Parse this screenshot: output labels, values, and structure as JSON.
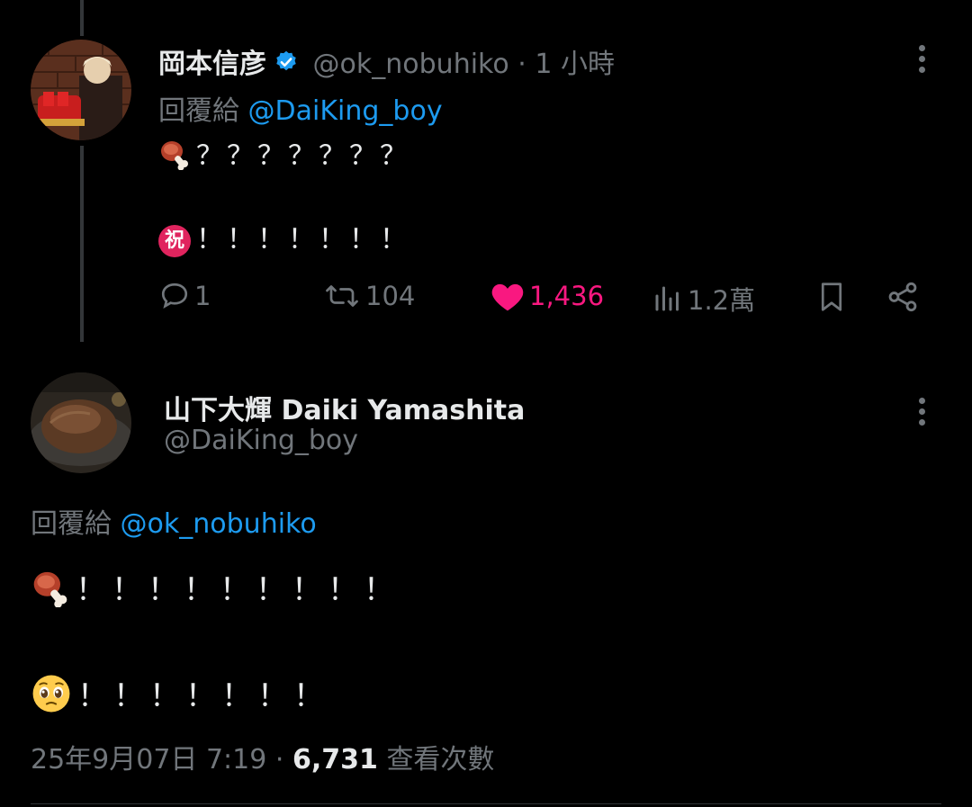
{
  "reply_tweet": {
    "display_name": "岡本信彦",
    "handle": "@ok_nobuhiko",
    "time": "· 1 小時",
    "reply_prefix": "回覆給",
    "reply_to": "@DaiKing_boy",
    "line1": "？？？？？？？",
    "line2": "！！！！！！！",
    "emoji1": "meat-on-bone-emoji",
    "emoji2": "congratulation-emoji",
    "congrat_char": "祝",
    "actions": {
      "replies": "1",
      "retweets": "104",
      "likes": "1,436",
      "views": "1.2萬"
    },
    "colors": {
      "like": "#f91880",
      "link": "#1d9bf0",
      "verified": "#1d9bf0"
    }
  },
  "main_tweet": {
    "display_name": "山下大輝 Daiki Yamashita",
    "handle": "@DaiKing_boy",
    "reply_prefix": "回覆給",
    "reply_to": "@ok_nobuhiko",
    "line1": "！！！！！！！！！",
    "line2": "！！！！！！！",
    "emoji1": "meat-on-bone-emoji",
    "emoji2": "pleading-face-emoji",
    "timestamp": "25年9月07日 7:19",
    "separator": "·",
    "view_count": "6,731",
    "view_label": "查看次數"
  }
}
